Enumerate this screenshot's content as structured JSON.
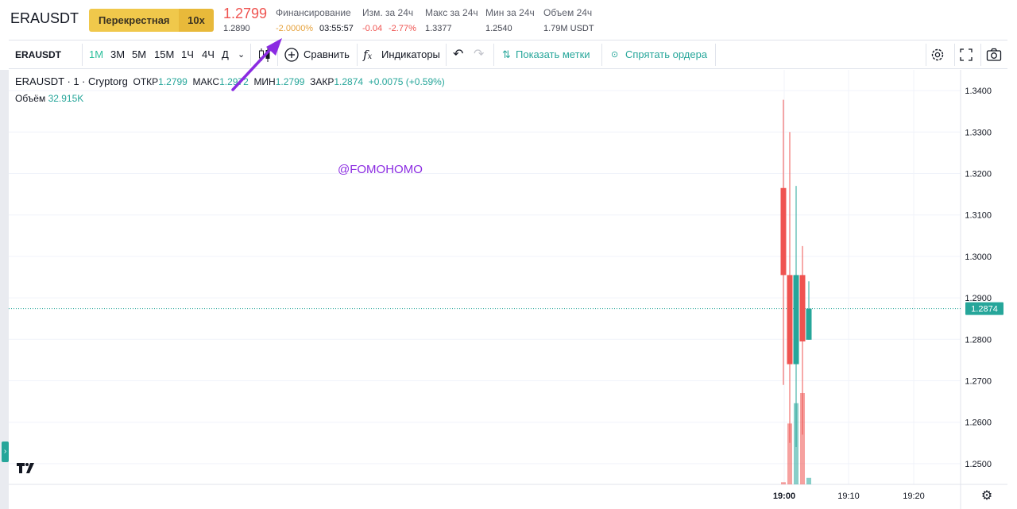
{
  "header": {
    "symbol": "ERAUSDT",
    "margin_mode": "Перекрестная",
    "leverage": "10x",
    "last_price": "1.2799",
    "mark_price": "1.2890",
    "funding": {
      "label": "Финансирование",
      "rate": "-2.0000%",
      "countdown": "03:55:57"
    },
    "change_24h": {
      "label": "Изм. за 24ч",
      "abs": "-0.04",
      "pct": "-2.77%"
    },
    "high_24h": {
      "label": "Макс за 24ч",
      "value": "1.3377"
    },
    "low_24h": {
      "label": "Мин за 24ч",
      "value": "1.2540"
    },
    "volume_24h": {
      "label": "Объем 24ч",
      "value": "1.79M USDT"
    }
  },
  "toolbar": {
    "symbol": "ERAUSDT",
    "timeframes": [
      "1М",
      "3М",
      "5М",
      "15М",
      "1Ч",
      "4Ч",
      "Д"
    ],
    "active_timeframe": "1М",
    "compare_label": "Сравнить",
    "indicators_label": "Индикаторы",
    "show_marks_label": "Показать метки",
    "hide_orders_label": "Спрятать ордера"
  },
  "legend": {
    "symbol": "ERAUSDT",
    "interval": "1",
    "source": "Cryptorg",
    "open_label": "ОТКР",
    "open": "1.2799",
    "high_label": "МАКС",
    "high": "1.2972",
    "low_label": "МИН",
    "low": "1.2799",
    "close_label": "ЗАКР",
    "close": "1.2874",
    "change": "+0.0075 (+0.59%)",
    "volume_label": "Объём",
    "volume": "32.915K"
  },
  "watermark": "@FOMOHOMO",
  "colors": {
    "up": "#26a69a",
    "down": "#ef5350",
    "accent": "#f0c84b",
    "annotation": "#8b2be2"
  },
  "chart_data": {
    "type": "candlestick",
    "y_axis": {
      "min": 1.245,
      "max": 1.345,
      "ticks": [
        "1.3400",
        "1.3300",
        "1.3200",
        "1.3100",
        "1.3000",
        "1.2900",
        "1.2800",
        "1.2700",
        "1.2600",
        "1.2500"
      ]
    },
    "x_axis": {
      "ticks": [
        "19:00",
        "19:10",
        "19:20"
      ]
    },
    "last_price_label": "1.2874",
    "last_price": 1.2874,
    "candles": [
      {
        "o": 1.3165,
        "h": 1.3378,
        "l": 1.269,
        "c": 1.2955,
        "v": 0.3
      },
      {
        "o": 1.2955,
        "h": 1.33,
        "l": 1.255,
        "c": 1.274,
        "v": 8.4
      },
      {
        "o": 1.274,
        "h": 1.317,
        "l": 1.254,
        "c": 1.2955,
        "v": 11.2
      },
      {
        "o": 1.2955,
        "h": 1.3025,
        "l": 1.257,
        "c": 1.2795,
        "v": 12.6
      },
      {
        "o": 1.2799,
        "h": 1.294,
        "l": 1.2799,
        "c": 1.2874,
        "v": 0.9
      }
    ]
  }
}
